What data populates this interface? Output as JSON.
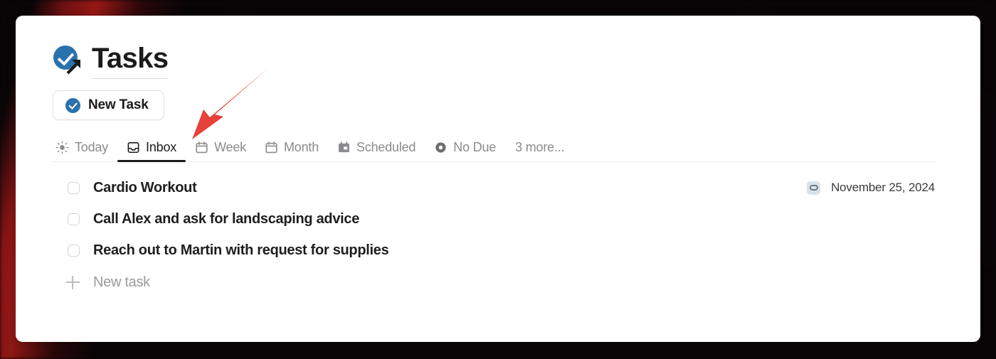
{
  "window": {
    "background_style": "dark-red-blurred-streaks",
    "card_background": "#ffffff"
  },
  "header": {
    "title": "Tasks",
    "app_icon": "tasks-check-external-link-icon",
    "accent_color": "#2a72ad"
  },
  "toolbar": {
    "new_task_label": "New Task",
    "new_task_icon": "check-circle-icon"
  },
  "tabs": {
    "active": "Inbox",
    "items": [
      {
        "label": "Today",
        "icon": "sun-icon",
        "active": false
      },
      {
        "label": "Inbox",
        "icon": "inbox-tray-icon",
        "active": true
      },
      {
        "label": "Week",
        "icon": "calendar-icon",
        "active": false
      },
      {
        "label": "Month",
        "icon": "calendar-icon",
        "active": false
      },
      {
        "label": "Scheduled",
        "icon": "calendar-filled-icon",
        "active": false
      },
      {
        "label": "No Due",
        "icon": "donut-circle-icon",
        "active": false
      }
    ],
    "more_label": "3 more..."
  },
  "task_list": {
    "rows": [
      {
        "title": "Cardio Workout",
        "checked": false,
        "repeat_icon": "repeat-icon",
        "date": "November 25, 2024"
      },
      {
        "title": "Call Alex and ask for landscaping advice",
        "checked": false,
        "repeat_icon": "",
        "date": ""
      },
      {
        "title": "Reach out to Martin with request for supplies",
        "checked": false,
        "repeat_icon": "",
        "date": ""
      }
    ],
    "add_row_label": "New task",
    "add_row_icon": "plus-icon"
  },
  "annotation": {
    "arrow_color": "#e8403a",
    "points_to": "Inbox"
  }
}
